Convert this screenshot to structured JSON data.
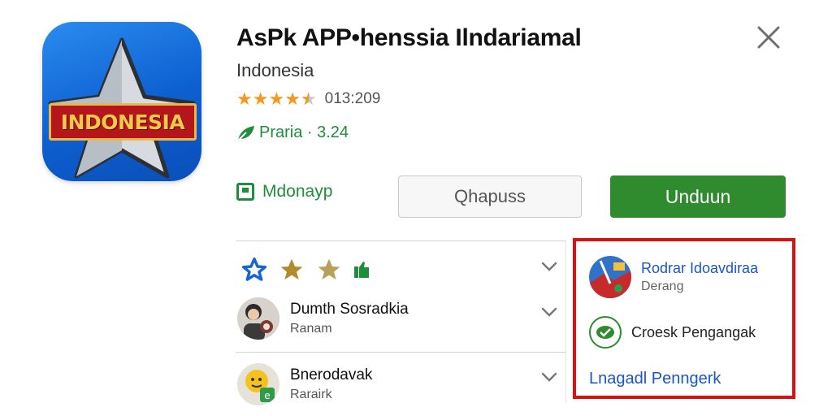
{
  "app": {
    "icon_banner_text": "INDONESIA",
    "title": "AsPk APP•henssia Ilndariamal",
    "subtitle": "Indonesia",
    "rating_value": 4.5,
    "rating_max": 5,
    "rating_count": "013:209",
    "price_label": "Praria · 3.24",
    "developer_label": "Mdonayp"
  },
  "actions": {
    "secondary_label": "Qhapuss",
    "primary_label": "Unduun",
    "close_icon": "close-icon"
  },
  "reviews": {
    "stars_row_icons": [
      "star-outline-blue-icon",
      "star-gold-icon",
      "star-gold-icon",
      "thumbs-up-icon"
    ],
    "items": [
      {
        "name": "Dumth Sosradkia",
        "meta": "Ranam"
      },
      {
        "name": "Bnerodavak",
        "meta": "Rarairk"
      }
    ]
  },
  "panel": {
    "border_color": "#e00f0f",
    "item1_title": "Rodrar Idoavdiraa",
    "item1_sub": "Derang",
    "item2_title": "Croesk Pengangak",
    "link_label": "Lnagadl Penngerk"
  },
  "colors": {
    "accent_green": "#2e8b2e",
    "link_blue": "#1a56c4",
    "star_orange": "#f29a1f"
  }
}
